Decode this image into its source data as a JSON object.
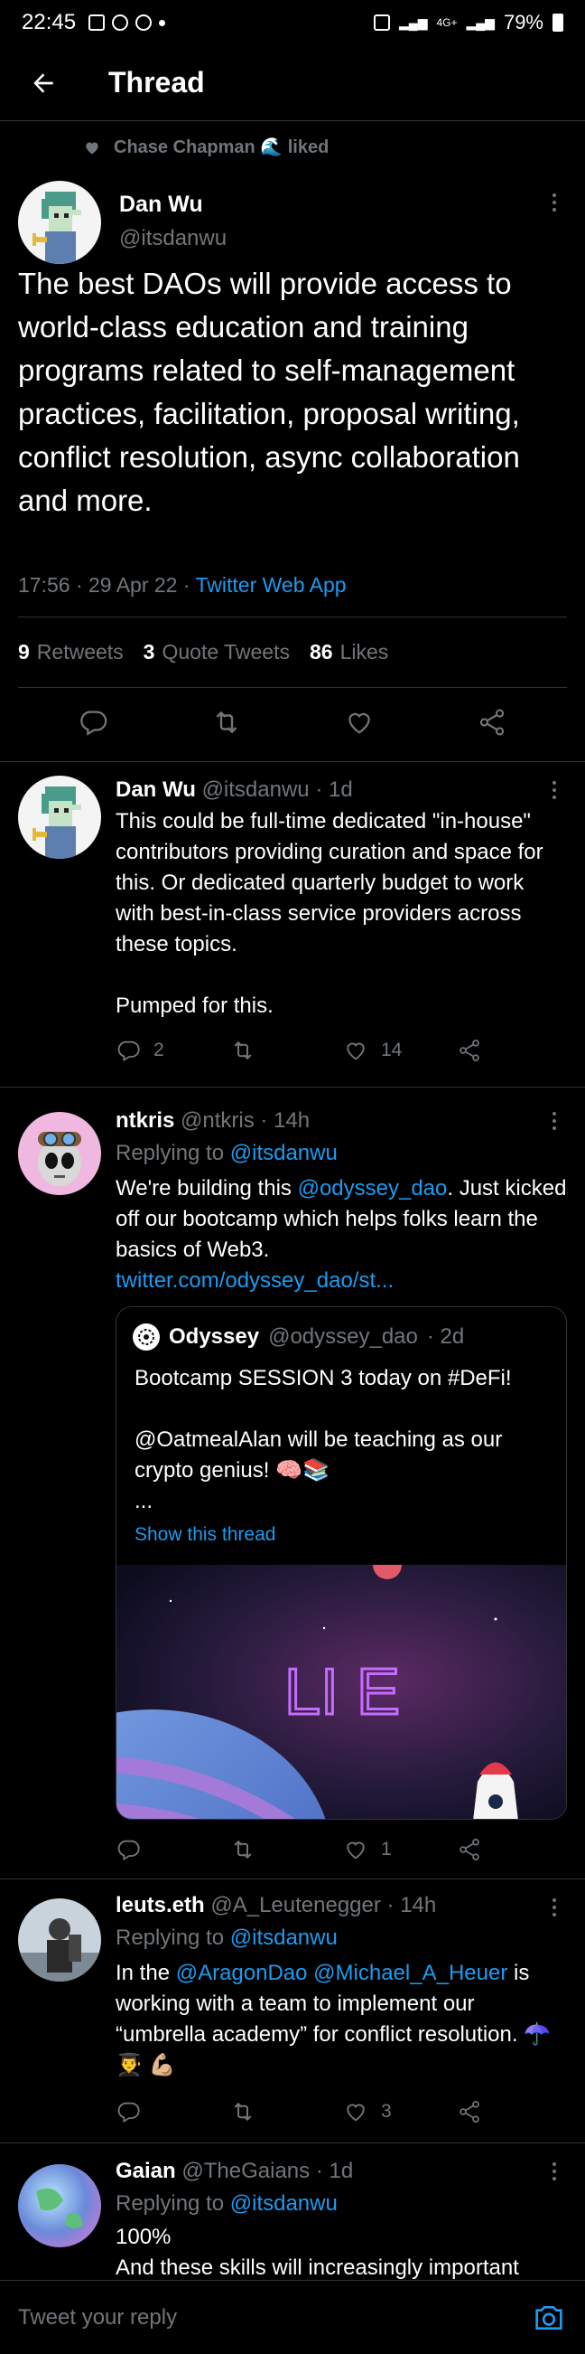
{
  "status_bar": {
    "time": "22:45",
    "network": "4G+",
    "battery": "79%"
  },
  "header": {
    "title": "Thread"
  },
  "main_tweet": {
    "liked_by": "Chase Chapman",
    "liked_suffix": "liked",
    "liked_emoji": "🌊",
    "name": "Dan Wu",
    "handle": "@itsdanwu",
    "text": "The best DAOs will provide access to world-class education and training programs related to self-management practices, facilitation, proposal writing, conflict resolution, async collaboration and more.",
    "time": "17:56 · 29 Apr 22 ·",
    "source": "Twitter Web App",
    "stats": {
      "retweets_count": "9",
      "retweets_label": "Retweets",
      "quotes_count": "3",
      "quotes_label": "Quote Tweets",
      "likes_count": "86",
      "likes_label": "Likes"
    }
  },
  "replies": [
    {
      "name": "Dan Wu",
      "handle": "@itsdanwu",
      "time": "· 1d",
      "text_1": "This could be full-time dedicated \"in-house\" contributors providing curation and space for this. Or dedicated quarterly budget to work with best-in-class service providers across these topics.",
      "text_2": "Pumped for this.",
      "replies_count": "2",
      "retweets_count": "",
      "likes_count": "14"
    },
    {
      "name": "ntkris",
      "handle": "@ntkris",
      "time": "· 14h",
      "replying_label": "Replying to",
      "replying_to": "@itsdanwu",
      "text_pre": "We're building this ",
      "mention": "@odyssey_dao",
      "text_post": ". Just kicked off our bootcamp which helps folks learn the basics of Web3.",
      "link": "twitter.com/odyssey_dao/st...",
      "quote": {
        "name": "Odyssey",
        "handle": "@odyssey_dao",
        "time": "· 2d",
        "line_1": "Bootcamp SESSION 3 today on #DeFi!",
        "line_2": "@OatmealAlan will be teaching as our crypto genius! 🧠📚",
        "line_3": "...",
        "show_thread": "Show this thread",
        "image_text": "LI    E"
      },
      "replies_count": "",
      "retweets_count": "",
      "likes_count": "1"
    },
    {
      "name": "leuts.eth",
      "handle": "@A_Leutenegger",
      "time": "· 14h",
      "replying_label": "Replying to",
      "replying_to": "@itsdanwu",
      "text_pre": "In the ",
      "mention_1": "@AragonDao",
      "mention_2": "@Michael_A_Heuer",
      "text_post": " is working with a team to implement our “umbrella academy” for conflict resolution. ☂️ 👨‍🎓 💪🏼",
      "replies_count": "",
      "retweets_count": "",
      "likes_count": "3"
    },
    {
      "name": "Gaian",
      "handle": "@TheGaians",
      "time": "· 1d",
      "replying_label": "Replying to",
      "replying_to": "@itsdanwu",
      "text_1": "100%",
      "text_2": "And these skills will increasingly important"
    }
  ],
  "reply_bar": {
    "placeholder": "Tweet your reply"
  },
  "colors": {
    "accent": "#1d9bf0",
    "background": "#000000",
    "muted": "#71767b",
    "divider": "#2f3336"
  }
}
